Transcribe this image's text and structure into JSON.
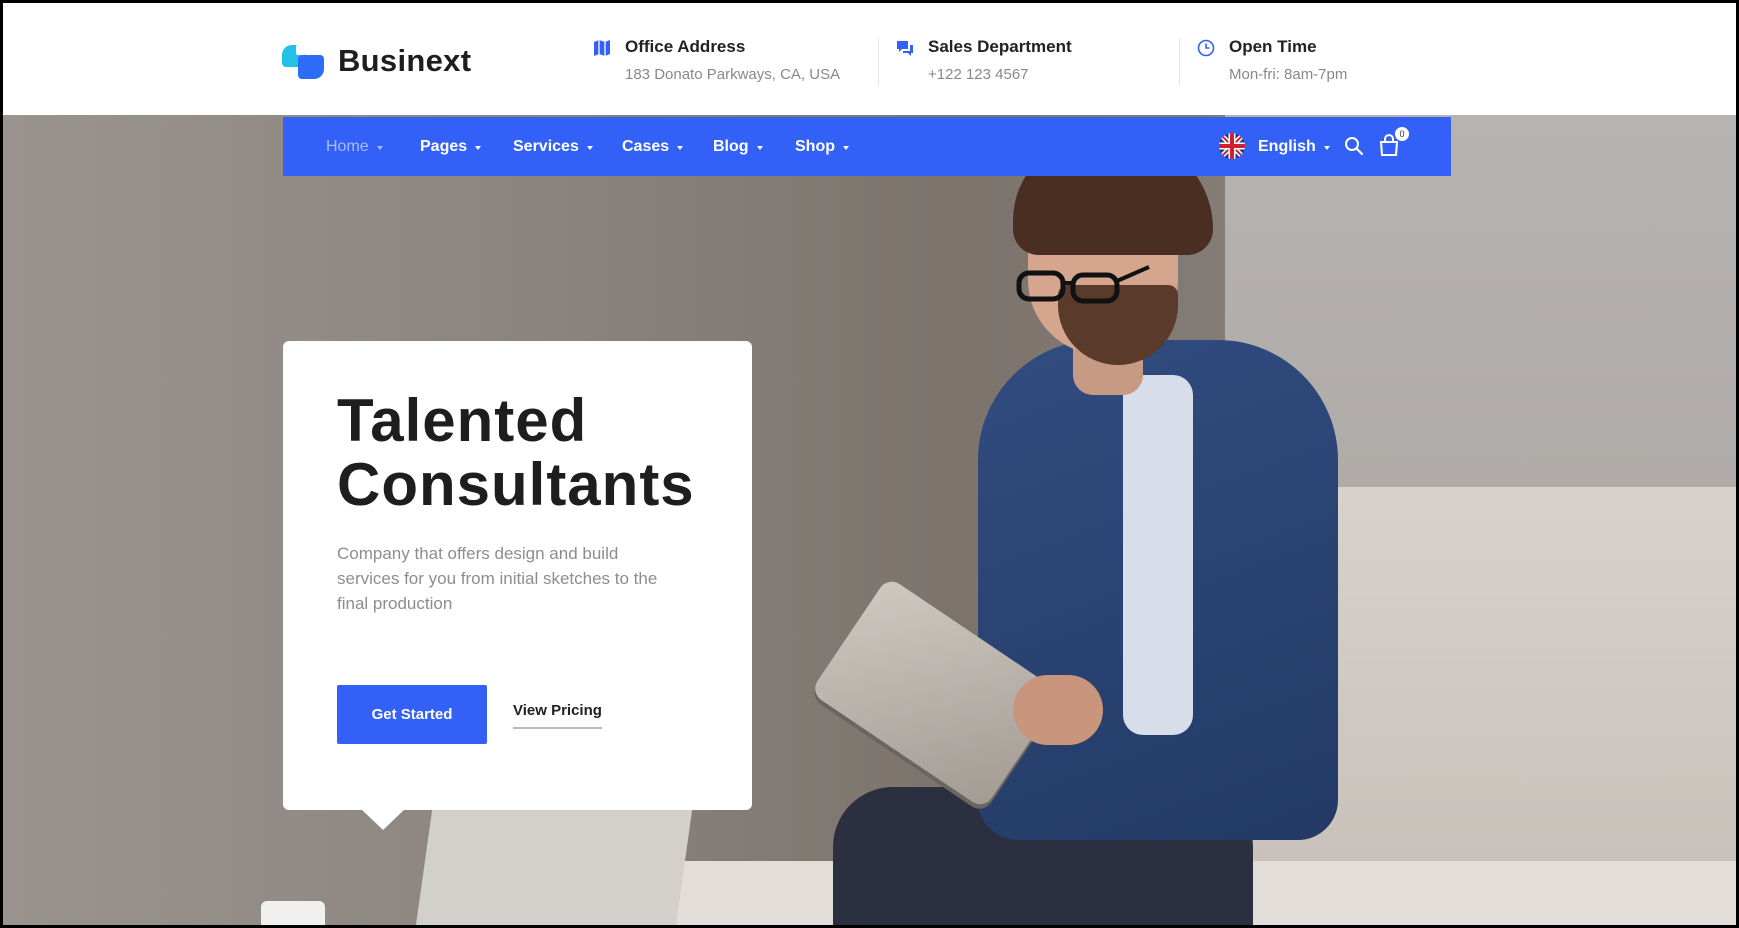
{
  "brand": {
    "name": "Businext"
  },
  "header": {
    "info": [
      {
        "title": "Office Address",
        "value": "183 Donato Parkways, CA, USA",
        "icon": "map-icon"
      },
      {
        "title": "Sales Department",
        "value": "+122 123 4567",
        "icon": "chat-icon"
      },
      {
        "title": "Open Time",
        "value": "Mon-fri: 8am-7pm",
        "icon": "clock-icon"
      }
    ]
  },
  "nav": {
    "items": [
      {
        "label": "Home",
        "active": true
      },
      {
        "label": "Pages"
      },
      {
        "label": "Services"
      },
      {
        "label": "Cases"
      },
      {
        "label": "Blog"
      },
      {
        "label": "Shop"
      }
    ],
    "language": "English",
    "cart_count": "0"
  },
  "hero": {
    "title_line1": "Talented",
    "title_line2": "Consultants",
    "description": "Company that offers design and build services for you from initial sketches to the final production",
    "primary_button": "Get Started",
    "secondary_link": "View Pricing"
  },
  "colors": {
    "accent": "#3361f7",
    "logo_cyan": "#23c1e8"
  }
}
